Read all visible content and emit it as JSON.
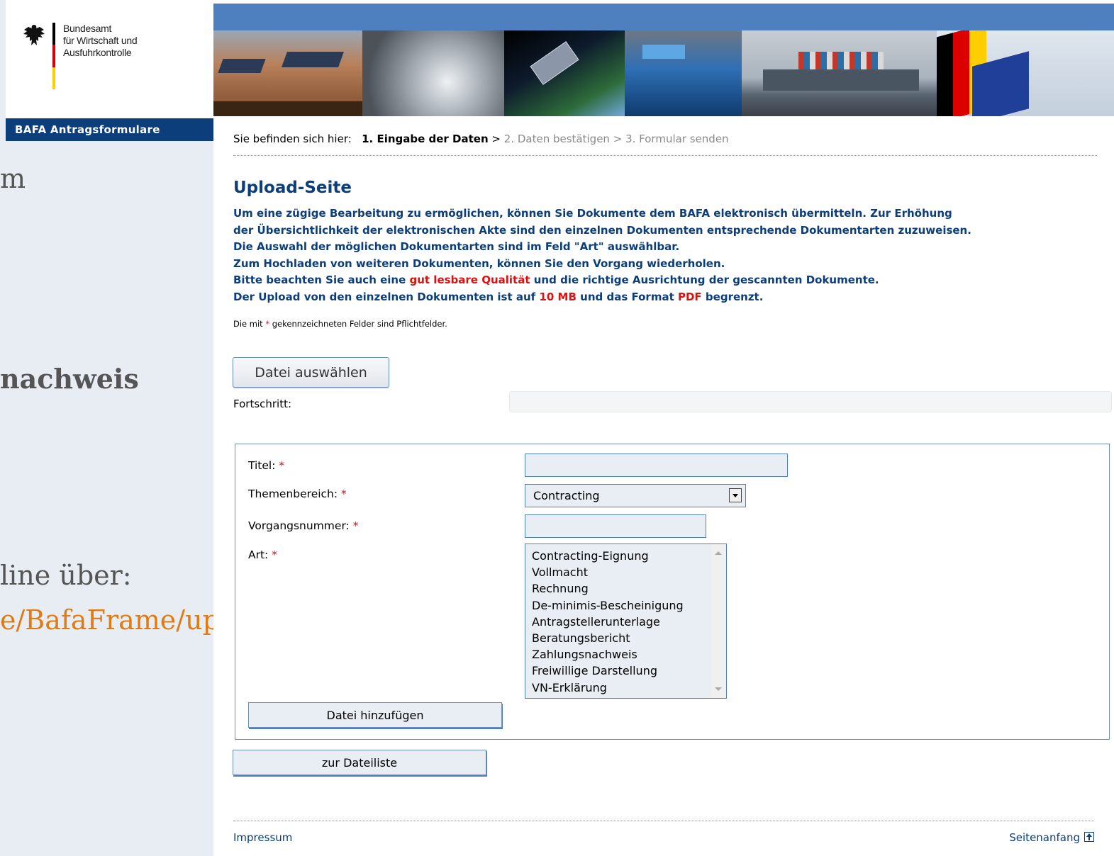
{
  "background_page": {
    "fragments": [
      "m",
      "nachweis",
      "line über:"
    ],
    "link_text": "e/BafaFrame/upload"
  },
  "header": {
    "org_name_lines": [
      "Bundesamt",
      "für Wirtschaft und",
      "Ausfuhrkontrolle"
    ],
    "nav_title": "BAFA Antragsformulare"
  },
  "breadcrumb": {
    "prefix": "Sie befinden sich hier:",
    "step1": "1. Eingabe der Daten",
    "separator": ">",
    "step2": "2. Daten bestätigen",
    "step3": "3. Formular senden"
  },
  "page": {
    "heading": "Upload-Seite",
    "intro": {
      "line1": "Um eine zügige Bearbeitung zu ermöglichen, können Sie Dokumente dem BAFA elektronisch übermitteln. Zur Erhöhung",
      "line2": "der Übersichtlichkeit der elektronischen Akte sind den einzelnen Dokumenten entsprechende Dokumentarten zuzuweisen.",
      "line3": "Die Auswahl der möglichen Dokumentarten sind im Feld \"Art\" auswählbar.",
      "line4": "Zum Hochladen von weiteren Dokumenten, können Sie den Vorgang wiederholen.",
      "line5_pre": "Bitte beachten Sie auch eine",
      "line5_red": "gut lesbare Qualität",
      "line5_post": "und die richtige Ausrichtung der gescannten Dokumente.",
      "line6_pre": "Der Upload von den einzelnen Dokumenten ist auf",
      "line6_red1": "10 MB",
      "line6_mid": "und das Format",
      "line6_red2": "PDF",
      "line6_post": "begrenzt."
    },
    "mandatory_pre": "Die mit",
    "mandatory_star": "*",
    "mandatory_post": "gekennzeichneten Felder sind Pflichtfelder."
  },
  "upload": {
    "choose_button": "Datei auswählen",
    "progress_label": "Fortschritt:",
    "progress": 0
  },
  "form": {
    "title_label": "Titel:",
    "title_value": "",
    "topic_label": "Themenbereich:",
    "topic_value": "Contracting",
    "case_label": "Vorgangsnummer:",
    "case_value": "",
    "type_label": "Art:",
    "type_options": [
      "Contracting-Eignung",
      "Vollmacht",
      "Rechnung",
      "De-minimis-Bescheinigung",
      "Antragstellerunterlage",
      "Beratungsbericht",
      "Zahlungsnachweis",
      "Freiwillige Darstellung",
      "VN-Erklärung"
    ],
    "required_star": "*",
    "add_button": "Datei hinzufügen"
  },
  "to_list_button": "zur Dateiliste",
  "footer": {
    "impressum": "Impressum",
    "top_link": "Seitenanfang"
  },
  "colors": {
    "brand_blue": "#0b3e7a",
    "top_bar": "#4e7fbf",
    "required_red": "#e01010",
    "link_orange": "#e07b14"
  },
  "icons": [
    "federal-eagle-icon",
    "dropdown-arrow-icon",
    "scroll-up-icon",
    "scroll-down-icon",
    "back-to-top-icon"
  ]
}
